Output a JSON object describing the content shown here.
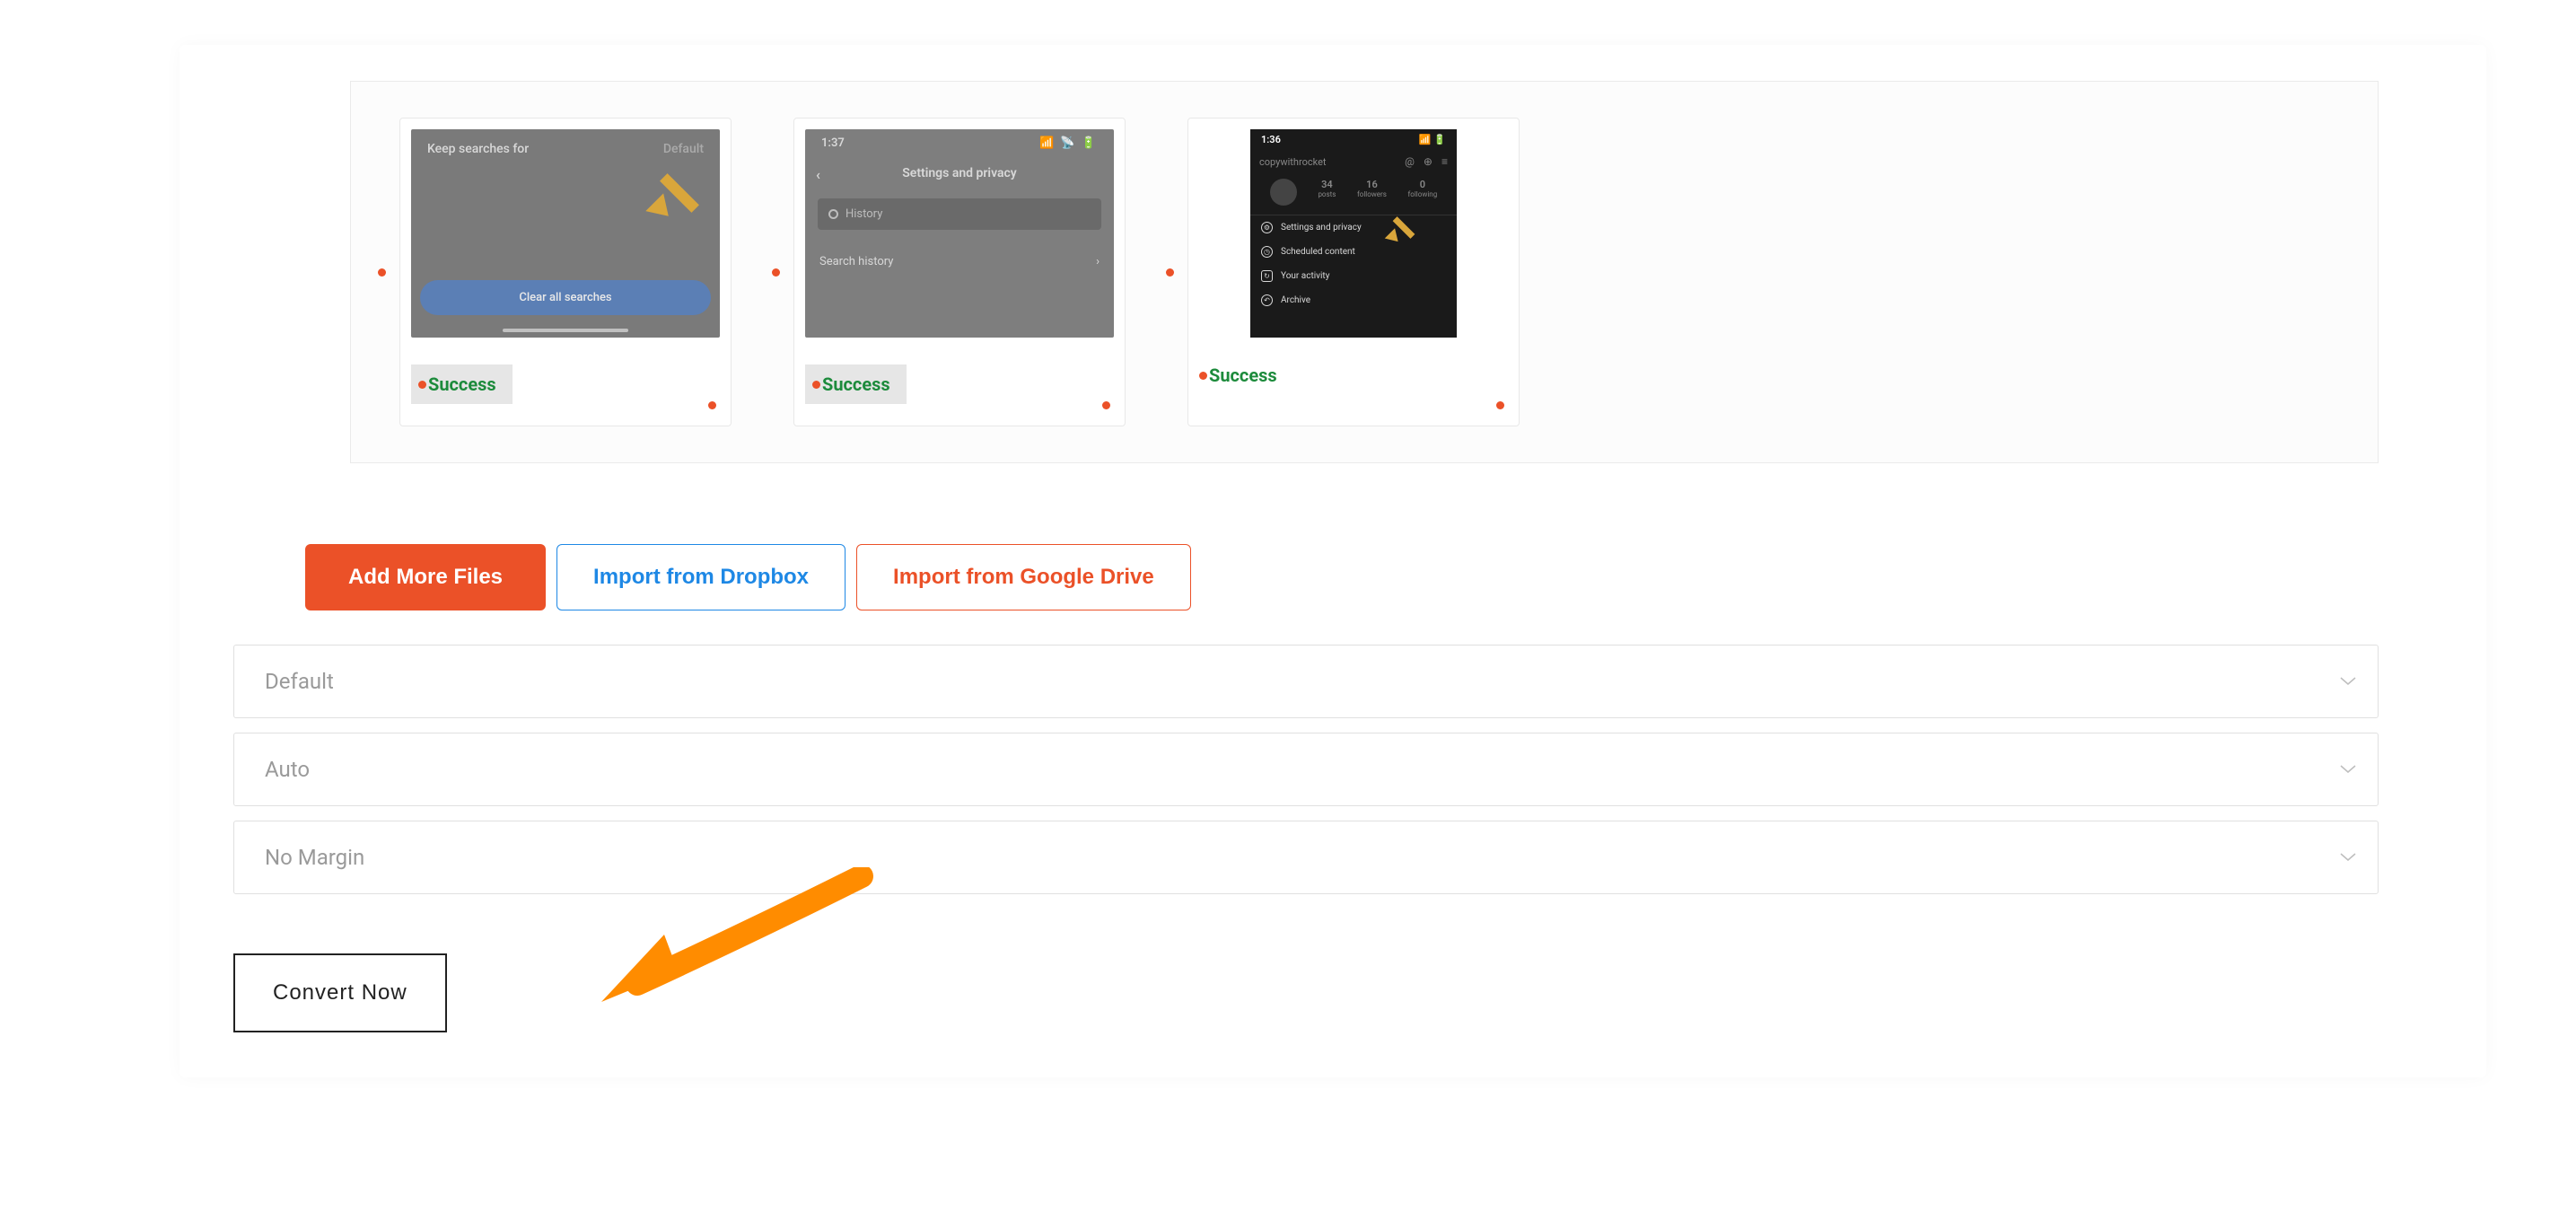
{
  "colors": {
    "accent": "#EB5128",
    "success": "#1d8b3c",
    "dropbox_blue": "#1e88e5",
    "arrow_orange": "#FF8C00"
  },
  "files": [
    {
      "status": "Success",
      "thumb": {
        "top_left": "Keep searches for",
        "top_right": "Default",
        "button": "Clear all searches"
      }
    },
    {
      "status": "Success",
      "thumb": {
        "time": "1:37",
        "signal": "📶 📡 🔋",
        "header": "Settings and privacy",
        "search_placeholder": "History",
        "row1": "Search history"
      }
    },
    {
      "status": "Success",
      "thumb": {
        "time": "1:36",
        "signal": "📶 🔋",
        "username": "copywithrocket",
        "stats": [
          {
            "num": "34",
            "lbl": "posts"
          },
          {
            "num": "16",
            "lbl": "followers"
          },
          {
            "num": "0",
            "lbl": "following"
          }
        ],
        "menu": [
          "Settings and privacy",
          "Scheduled content",
          "Your activity",
          "Archive"
        ]
      }
    }
  ],
  "buttons": {
    "add_files": "Add More Files",
    "dropbox": "Import from Dropbox",
    "gdrive": "Import from Google Drive"
  },
  "selects": {
    "orientation": "Default",
    "size": "Auto",
    "margin": "No Margin"
  },
  "convert": "Convert Now"
}
